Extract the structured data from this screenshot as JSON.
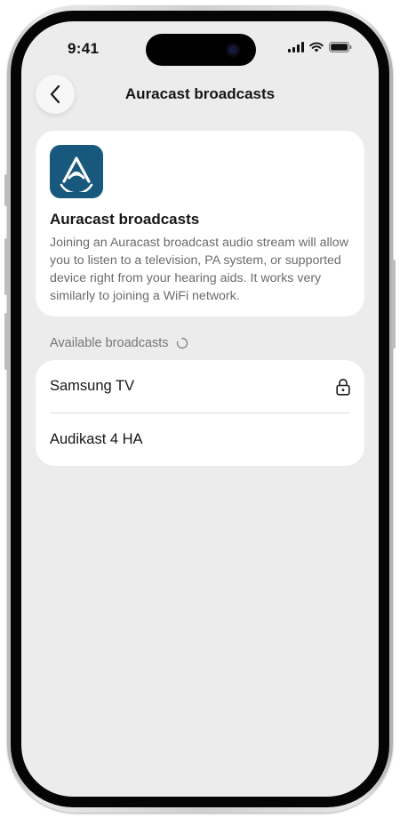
{
  "status_bar": {
    "time": "9:41"
  },
  "nav": {
    "title": "Auracast broadcasts",
    "back_icon": "chevron-left-icon"
  },
  "info_card": {
    "logo_icon": "auracast-logo-icon",
    "title": "Auracast broadcasts",
    "description": "Joining an Auracast broadcast audio stream will allow you to listen to a television, PA system, or supported device right from your hearing aids. It works very similarly to joining a WiFi network."
  },
  "broadcasts": {
    "header": "Available broadcasts",
    "loading_icon": "spinner-icon",
    "items": [
      {
        "name": "Samsung TV",
        "icon": "lock-icon"
      },
      {
        "name": "Audikast 4 HA",
        "icon": ""
      }
    ]
  },
  "colors": {
    "screen_background": "#ececec",
    "card_background": "#ffffff",
    "logo_background": "#17587c",
    "primary_text": "#161616",
    "secondary_text": "#6b6b6b"
  }
}
